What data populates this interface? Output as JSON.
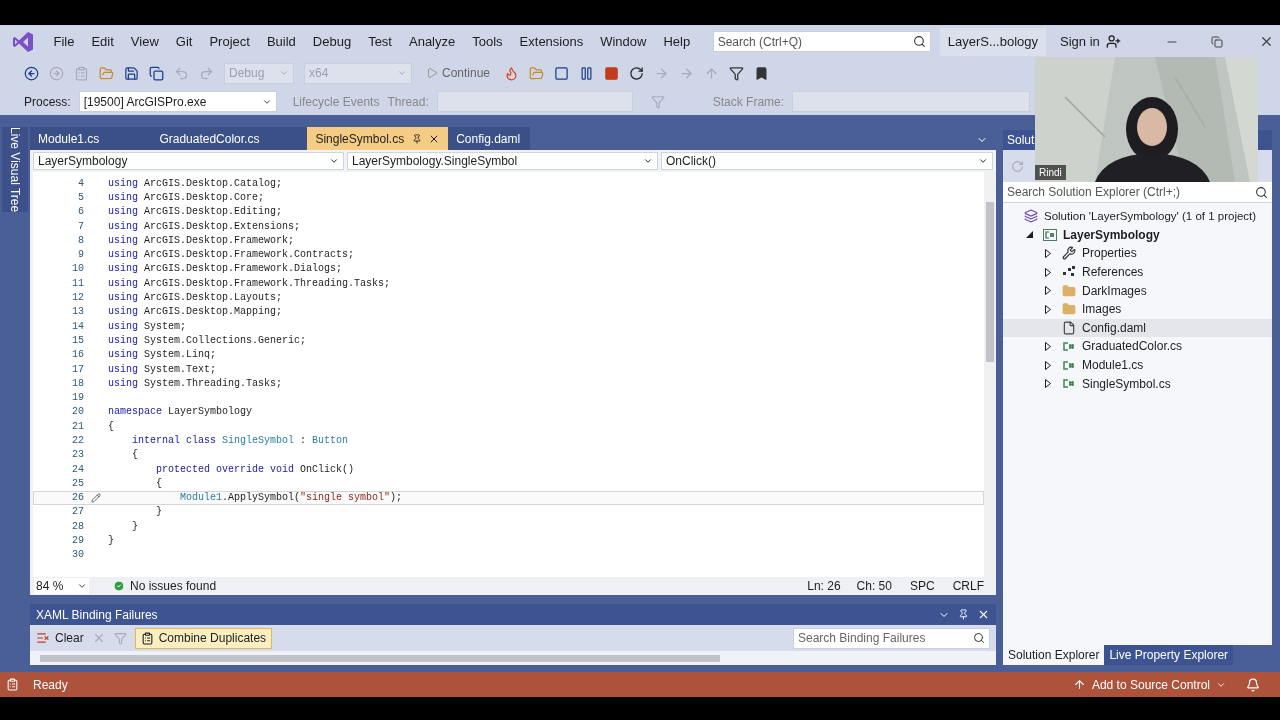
{
  "menu": [
    "File",
    "Edit",
    "View",
    "Git",
    "Project",
    "Build",
    "Debug",
    "Test",
    "Analyze",
    "Tools",
    "Extensions",
    "Window",
    "Help"
  ],
  "search": {
    "placeholder": "Search (Ctrl+Q)"
  },
  "window": {
    "title": "LayerS...bology",
    "sign_in": "Sign in"
  },
  "toolbar": {
    "configuration": {
      "value": "Debug",
      "disabled": true
    },
    "platform": {
      "value": "x64",
      "disabled": true
    },
    "continue": "Continue"
  },
  "debug_location": {
    "process_label": "Process:",
    "process": {
      "value": "[19500] ArcGISPro.exe",
      "disabled": false
    },
    "lifecycle": "Lifecycle Events",
    "thread_label": "Thread:",
    "stack_frame_label": "Stack Frame:"
  },
  "side_strip": {
    "label": "Live Visual Tree"
  },
  "tabs": [
    {
      "label": "Module1.cs",
      "selected": false
    },
    {
      "label": "GraduatedColor.cs",
      "selected": false
    },
    {
      "label": "SingleSymbol.cs",
      "selected": true
    },
    {
      "label": "Config.daml",
      "selected": false
    }
  ],
  "navigation": [
    "LayerSymbology",
    "LayerSymbology.SingleSymbol",
    "OnClick()"
  ],
  "code": [
    {
      "n": "4",
      "current": false,
      "tokens": [
        {
          "text": "using",
          "kind": "keyword"
        },
        {
          "text": " ArcGIS.Desktop.Catalog;",
          "kind": "plain"
        }
      ]
    },
    {
      "n": "5",
      "current": false,
      "tokens": [
        {
          "text": "using",
          "kind": "keyword"
        },
        {
          "text": " ArcGIS.Desktop.Core;",
          "kind": "plain"
        }
      ]
    },
    {
      "n": "6",
      "current": false,
      "tokens": [
        {
          "text": "using",
          "kind": "keyword"
        },
        {
          "text": " ArcGIS.Desktop.Editing;",
          "kind": "plain"
        }
      ]
    },
    {
      "n": "7",
      "current": false,
      "tokens": [
        {
          "text": "using",
          "kind": "keyword"
        },
        {
          "text": " ArcGIS.Desktop.Extensions;",
          "kind": "plain"
        }
      ]
    },
    {
      "n": "8",
      "current": false,
      "tokens": [
        {
          "text": "using",
          "kind": "keyword"
        },
        {
          "text": " ArcGIS.Desktop.Framework;",
          "kind": "plain"
        }
      ]
    },
    {
      "n": "9",
      "current": false,
      "tokens": [
        {
          "text": "using",
          "kind": "keyword"
        },
        {
          "text": " ArcGIS.Desktop.Framework.Contracts;",
          "kind": "plain"
        }
      ]
    },
    {
      "n": "10",
      "current": false,
      "tokens": [
        {
          "text": "using",
          "kind": "keyword"
        },
        {
          "text": " ArcGIS.Desktop.Framework.Dialogs;",
          "kind": "plain"
        }
      ]
    },
    {
      "n": "11",
      "current": false,
      "tokens": [
        {
          "text": "using",
          "kind": "keyword"
        },
        {
          "text": " ArcGIS.Desktop.Framework.Threading.Tasks;",
          "kind": "plain"
        }
      ]
    },
    {
      "n": "12",
      "current": false,
      "tokens": [
        {
          "text": "using",
          "kind": "keyword"
        },
        {
          "text": " ArcGIS.Desktop.Layouts;",
          "kind": "plain"
        }
      ]
    },
    {
      "n": "13",
      "current": false,
      "tokens": [
        {
          "text": "using",
          "kind": "keyword"
        },
        {
          "text": " ArcGIS.Desktop.Mapping;",
          "kind": "plain"
        }
      ]
    },
    {
      "n": "14",
      "current": false,
      "tokens": [
        {
          "text": "using",
          "kind": "keyword"
        },
        {
          "text": " System;",
          "kind": "plain"
        }
      ]
    },
    {
      "n": "15",
      "current": false,
      "tokens": [
        {
          "text": "using",
          "kind": "keyword"
        },
        {
          "text": " System.Collections.Generic;",
          "kind": "plain"
        }
      ]
    },
    {
      "n": "16",
      "current": false,
      "tokens": [
        {
          "text": "using",
          "kind": "keyword"
        },
        {
          "text": " System.Linq;",
          "kind": "plain"
        }
      ]
    },
    {
      "n": "17",
      "current": false,
      "tokens": [
        {
          "text": "using",
          "kind": "keyword"
        },
        {
          "text": " System.Text;",
          "kind": "plain"
        }
      ]
    },
    {
      "n": "18",
      "current": false,
      "tokens": [
        {
          "text": "using",
          "kind": "keyword"
        },
        {
          "text": " System.Threading.Tasks;",
          "kind": "plain"
        }
      ]
    },
    {
      "n": "19",
      "current": false
    },
    {
      "n": "20",
      "current": false,
      "tokens": [
        {
          "text": "namespace",
          "kind": "keyword"
        },
        {
          "text": " LayerSymbology",
          "kind": "plain"
        }
      ]
    },
    {
      "n": "21",
      "current": false,
      "tokens": [
        {
          "text": "{",
          "kind": "plain"
        }
      ]
    },
    {
      "n": "22",
      "current": false,
      "tokens": [
        {
          "text": "    internal class",
          "kind": "keyword"
        },
        {
          "text": " SingleSymbol",
          "kind": "type"
        },
        {
          "text": " : ",
          "kind": "plain"
        },
        {
          "text": "Button",
          "kind": "type"
        }
      ]
    },
    {
      "n": "23",
      "current": false,
      "tokens": [
        {
          "text": "    {",
          "kind": "plain"
        }
      ]
    },
    {
      "n": "24",
      "current": false,
      "tokens": [
        {
          "text": "        protected override void",
          "kind": "keyword"
        },
        {
          "text": " OnClick()",
          "kind": "plain"
        }
      ]
    },
    {
      "n": "25",
      "current": false,
      "tokens": [
        {
          "text": "        {",
          "kind": "plain"
        }
      ]
    },
    {
      "n": "26",
      "current": true,
      "tokens": [
        {
          "text": "            Module1",
          "kind": "type"
        },
        {
          "text": ".ApplySymbol(",
          "kind": "plain"
        },
        {
          "text": "\"single symbol\"",
          "kind": "string"
        },
        {
          "text": ");",
          "kind": "plain"
        }
      ]
    },
    {
      "n": "27",
      "current": false,
      "tokens": [
        {
          "text": "        }",
          "kind": "plain"
        }
      ]
    },
    {
      "n": "28",
      "current": false,
      "tokens": [
        {
          "text": "    }",
          "kind": "plain"
        }
      ]
    },
    {
      "n": "29",
      "current": false,
      "tokens": [
        {
          "text": "}",
          "kind": "plain"
        }
      ]
    },
    {
      "n": "30",
      "current": false
    }
  ],
  "editor_status": {
    "zoom": "84 %",
    "issues": "No issues found",
    "line": "Ln: 26",
    "column": "Ch: 50",
    "whitespace": "SPC",
    "line_ending": "CRLF"
  },
  "xaml_panel": {
    "title": "XAML Binding Failures",
    "clear": "Clear",
    "combine": {
      "label": "Combine Duplicates",
      "selected": true
    },
    "search": {
      "placeholder": "Search Binding Failures"
    }
  },
  "solution_explorer": {
    "title": "Solut",
    "search": {
      "placeholder": "Search Solution Explorer (Ctrl+;)"
    },
    "tree": [
      {
        "label": "Solution 'LayerSymbology' (1 of 1 project)",
        "kind": "solution",
        "selected": false,
        "children": [
          {
            "label": "LayerSymbology",
            "kind": "project",
            "expandable": true,
            "expanded": true,
            "selected": false,
            "children": [
              {
                "label": "Properties",
                "kind": "wrench",
                "expandable": true,
                "expanded": false,
                "selected": false
              },
              {
                "label": "References",
                "kind": "references",
                "expandable": true,
                "expanded": false,
                "selected": false
              },
              {
                "label": "DarkImages",
                "kind": "folder",
                "expandable": true,
                "expanded": false,
                "selected": false
              },
              {
                "label": "Images",
                "kind": "folder",
                "expandable": true,
                "expanded": false,
                "selected": false
              },
              {
                "label": "Config.daml",
                "kind": "file",
                "expandable": false,
                "expanded": false,
                "selected": true
              },
              {
                "label": "GraduatedColor.cs",
                "kind": "csharp",
                "expandable": true,
                "expanded": false,
                "selected": false
              },
              {
                "label": "Module1.cs",
                "kind": "csharp",
                "expandable": true,
                "expanded": false,
                "selected": false
              },
              {
                "label": "SingleSymbol.cs",
                "kind": "csharp",
                "expandable": true,
                "expanded": false,
                "selected": false
              }
            ]
          }
        ]
      }
    ],
    "bottom_tabs": [
      {
        "label": "Solution Explorer",
        "selected": true
      },
      {
        "label": "Live Property Explorer",
        "selected": false
      }
    ]
  },
  "status_bar": {
    "state": "Ready",
    "source_control": "Add to Source Control"
  },
  "webcam": {
    "kind": "picture",
    "name": "Rindi"
  }
}
